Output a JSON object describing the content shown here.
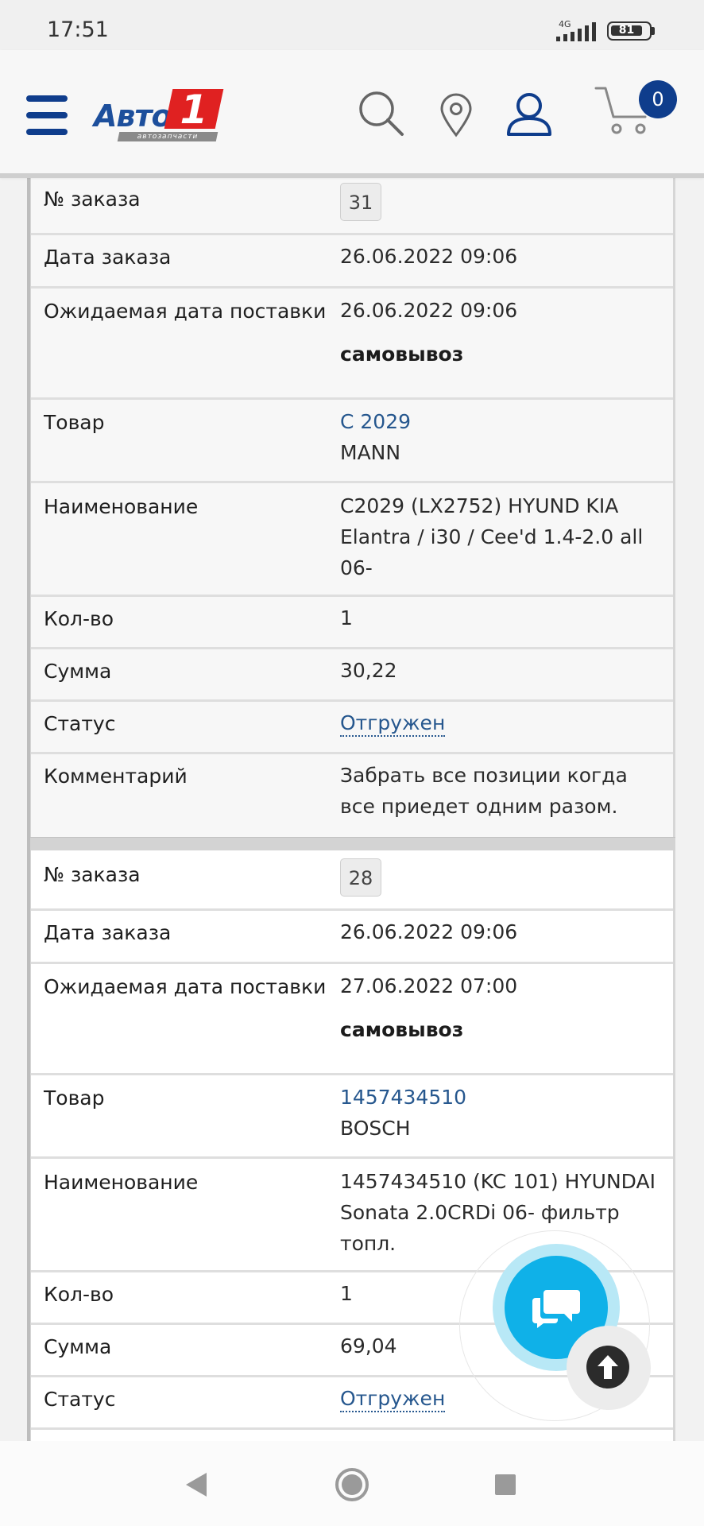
{
  "status_bar": {
    "time": "17:51",
    "network": "4G",
    "battery": "81"
  },
  "header": {
    "logo_text": "Авто",
    "logo_number": "1",
    "logo_subtitle": "автозапчасти",
    "cart_count": "0",
    "brand_color": "#0f3d8c",
    "logo_red": "#e02121"
  },
  "orders": [
    {
      "order_no_label": "№ заказа",
      "order_no": "31",
      "order_date_label": "Дата заказа",
      "order_date": "26.06.2022 09:06",
      "expected_label": "Ожидаемая дата поставки",
      "expected_date": "26.06.2022 09:06",
      "delivery": "самовывоз",
      "product_label": "Товар",
      "product_code": "C 2029",
      "product_brand": "MANN",
      "name_label": "Наименование",
      "name_line1": "C2029 (LX2752) HYUND KIA",
      "name_line2": "Elantra / i30 / Cee'd 1.4-2.0 all",
      "name_line3": "06-",
      "qty_label": "Кол-во",
      "qty": "1",
      "sum_label": "Сумма",
      "sum": "30,22",
      "status_label": "Статус",
      "status": "Отгружен",
      "comment_label": "Комментарий",
      "comment_line1": "Забрать все позиции когда",
      "comment_line2": "все приедет одним разом."
    },
    {
      "order_no_label": "№ заказа",
      "order_no": "28",
      "order_date_label": "Дата заказа",
      "order_date": "26.06.2022 09:06",
      "expected_label": "Ожидаемая дата поставки",
      "expected_date": "27.06.2022 07:00",
      "delivery": "самовывоз",
      "product_label": "Товар",
      "product_code": "1457434510",
      "product_brand": "BOSCH",
      "name_label": "Наименование",
      "name_line1": "1457434510 (KC 101) HYUNDAI",
      "name_line2": "Sonata 2.0CRDi 06- фильтр",
      "name_line3": "топл.",
      "qty_label": "Кол-во",
      "qty": "1",
      "sum_label": "Сумма",
      "sum": "69,04",
      "status_label": "Статус",
      "status": "Отгружен"
    }
  ],
  "colors": {
    "link": "#26578e",
    "chat_button": "#0fb1e8"
  }
}
